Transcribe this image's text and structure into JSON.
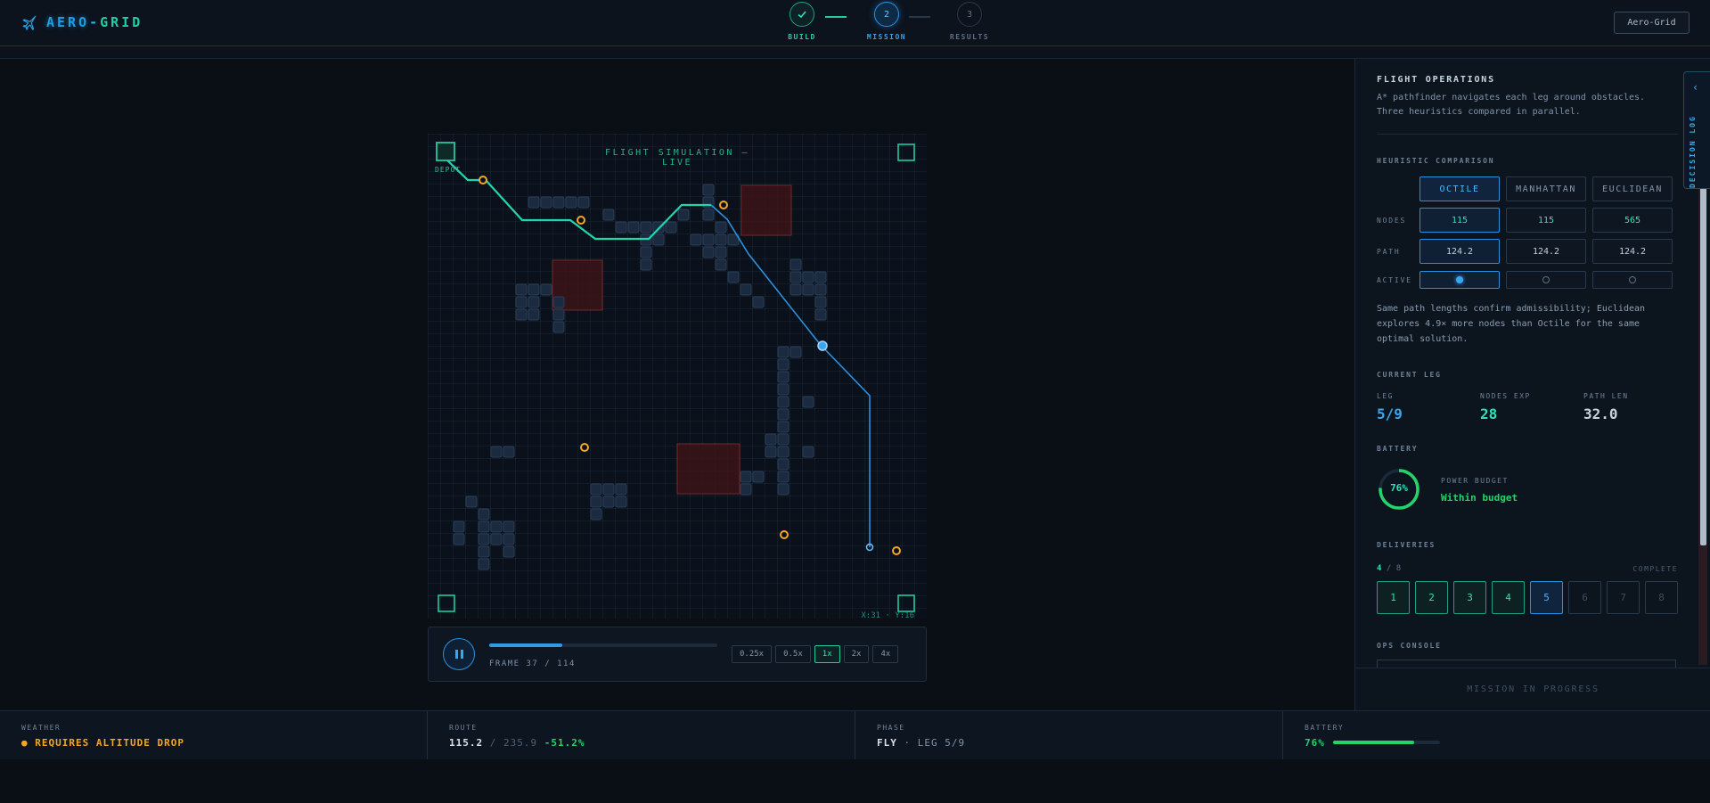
{
  "app": {
    "logo_a": "AERO",
    "logo_sep": "-",
    "logo_b": "GRID",
    "header_button": "Aero-Grid"
  },
  "stepper": [
    {
      "num": "",
      "label": "BUILD",
      "state": "done"
    },
    {
      "num": "2",
      "label": "MISSION",
      "state": "active"
    },
    {
      "num": "3",
      "label": "RESULTS",
      "state": "pending"
    }
  ],
  "map": {
    "title": "FLIGHT SIMULATION — LIVE",
    "depot_label": "DEPOT",
    "coords": "X:31 · Y:16"
  },
  "playback": {
    "progress": 0.32,
    "frame_label": "FRAME",
    "frame": "37",
    "frame_total": "114",
    "speeds": [
      "0.25x",
      "0.5x",
      "1x",
      "2x",
      "4x"
    ],
    "active_speed": "1x"
  },
  "panel": {
    "title": "FLIGHT OPERATIONS",
    "description": "A* pathfinder navigates each leg around obstacles. Three heuristics compared in parallel.",
    "heuristic_label": "HEURISTIC COMPARISON",
    "heuristics": [
      "OCTILE",
      "MANHATTAN",
      "EUCLIDEAN"
    ],
    "selected_heuristic": 0,
    "rows": {
      "nodes_label": "NODES",
      "nodes": [
        "115",
        "115",
        "565"
      ],
      "path_label": "PATH",
      "path": [
        "124.2",
        "124.2",
        "124.2"
      ],
      "active_label": "ACTIVE"
    },
    "analysis": "Same path lengths confirm admissibility; Euclidean explores 4.9× more nodes than Octile for the same optimal solution.",
    "current_leg_label": "CURRENT LEG",
    "leg_k": "LEG",
    "leg_v": "5/9",
    "nodes_exp_k": "NODES EXP",
    "nodes_exp_v": "28",
    "path_len_k": "PATH LEN",
    "path_len_v": "32.0",
    "battery_label": "BATTERY",
    "battery_percent_text": "76%",
    "battery_level": 0.76,
    "power_budget_k": "POWER BUDGET",
    "power_budget_v": "Within budget",
    "deliveries_label": "DELIVERIES",
    "deliveries_done": "4",
    "deliveries_total": "8",
    "deliveries_complete": "COMPLETE",
    "delivery_boxes": [
      "1",
      "2",
      "3",
      "4",
      "5",
      "6",
      "7",
      "8"
    ],
    "ops_console_label": "OPS CONSOLE",
    "footer": "MISSION IN PROGRESS",
    "decision_log": "DECISION LOG"
  },
  "status": {
    "weather_k": "WEATHER",
    "weather_v": "REQUIRES ALTITUDE DROP",
    "route_k": "ROUTE",
    "route_main": "115.2",
    "route_sep": " / ",
    "route_base": "235.9",
    "route_delta": "-51.2%",
    "phase_k": "PHASE",
    "phase_main": "FLY",
    "phase_rest": " · LEG 5/9",
    "battery_k": "BATTERY",
    "battery_v": "76%"
  },
  "colors": {
    "accent_teal": "#22c9a4",
    "accent_blue": "#2b8fe0",
    "warning": "#f5a623",
    "battery_green": "#22d46a",
    "no_fly": "#8a2a2a"
  }
}
